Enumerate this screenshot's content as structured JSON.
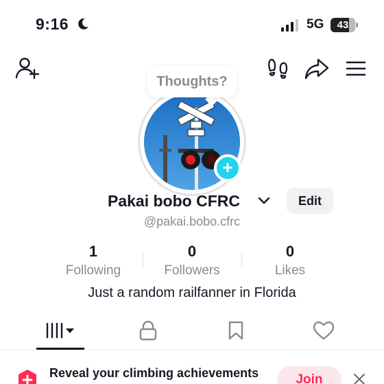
{
  "status_bar": {
    "time": "9:16",
    "network": "5G",
    "battery": "43"
  },
  "top_nav": {
    "icons": [
      "add-friend-icon",
      "footprints-icon",
      "share-icon",
      "menu-icon"
    ]
  },
  "profile": {
    "thoughts_prompt": "Thoughts?",
    "name": "Pakai bobo CFRC",
    "handle": "@pakai.bobo.cfrc",
    "edit_label": "Edit",
    "bio": "Just a random railfanner in Florida",
    "avatar_add": "+"
  },
  "stats": [
    {
      "value": "1",
      "label": "Following"
    },
    {
      "value": "0",
      "label": "Followers"
    },
    {
      "value": "0",
      "label": "Likes"
    }
  ],
  "tabs": [
    "videos-grid-icon",
    "lock-icon",
    "bookmark-icon",
    "heart-icon"
  ],
  "banner": {
    "text": "Reveal your climbing achievements",
    "join_label": "Join"
  },
  "colors": {
    "accent": "#fe2c55",
    "avatar_add": "#20d5ec",
    "secondary_text": "#8a8b91"
  }
}
